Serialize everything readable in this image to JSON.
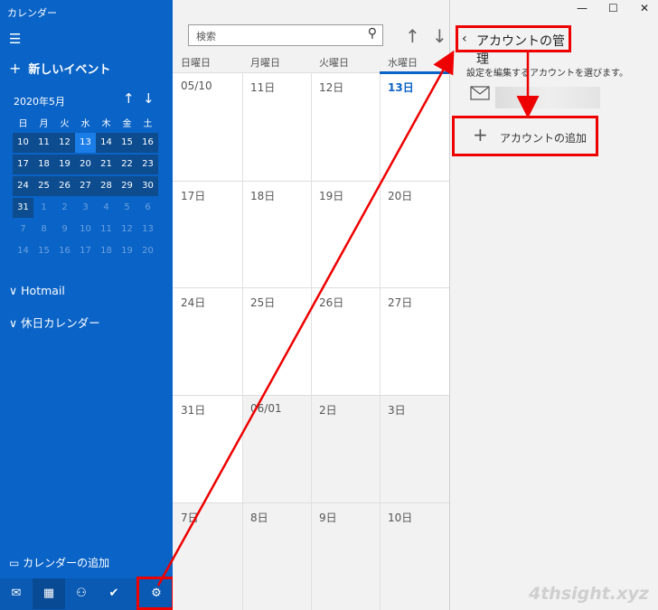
{
  "app": {
    "title": "カレンダー"
  },
  "sidebar": {
    "new_event": "新しいイベント",
    "mini": {
      "month": "2020年5月",
      "dow": [
        "日",
        "月",
        "火",
        "水",
        "木",
        "金",
        "土"
      ],
      "weeks": [
        [
          "10",
          "11",
          "12",
          "13",
          "14",
          "15",
          "16"
        ],
        [
          "17",
          "18",
          "19",
          "20",
          "21",
          "22",
          "23"
        ],
        [
          "24",
          "25",
          "26",
          "27",
          "28",
          "29",
          "30"
        ],
        [
          "31",
          "1",
          "2",
          "3",
          "4",
          "5",
          "6"
        ],
        [
          "7",
          "8",
          "9",
          "10",
          "11",
          "12",
          "13"
        ],
        [
          "14",
          "15",
          "16",
          "17",
          "18",
          "19",
          "20"
        ]
      ]
    },
    "sections": [
      "Hotmail",
      "休日カレンダー"
    ],
    "add_calendar": "カレンダーの追加"
  },
  "main": {
    "search_placeholder": "検索",
    "day_headers": [
      "日曜日",
      "月曜日",
      "火曜日",
      "水曜日"
    ],
    "rows": [
      [
        "05/10",
        "11日",
        "12日",
        "13日"
      ],
      [
        "17日",
        "18日",
        "19日",
        "20日"
      ],
      [
        "24日",
        "25日",
        "26日",
        "27日"
      ],
      [
        "31日",
        "06/01",
        "2日",
        "3日"
      ],
      [
        "7日",
        "8日",
        "9日",
        "10日"
      ]
    ]
  },
  "panel": {
    "title": "アカウントの管理",
    "instruction": "設定を編集するアカウントを選びます。",
    "add_account": "アカウントの追加"
  },
  "watermark": "4thsight.xyz",
  "colors": {
    "sidebar": "#0a63c6",
    "today": "#1b7ee8",
    "highlight": "#ee0000"
  }
}
